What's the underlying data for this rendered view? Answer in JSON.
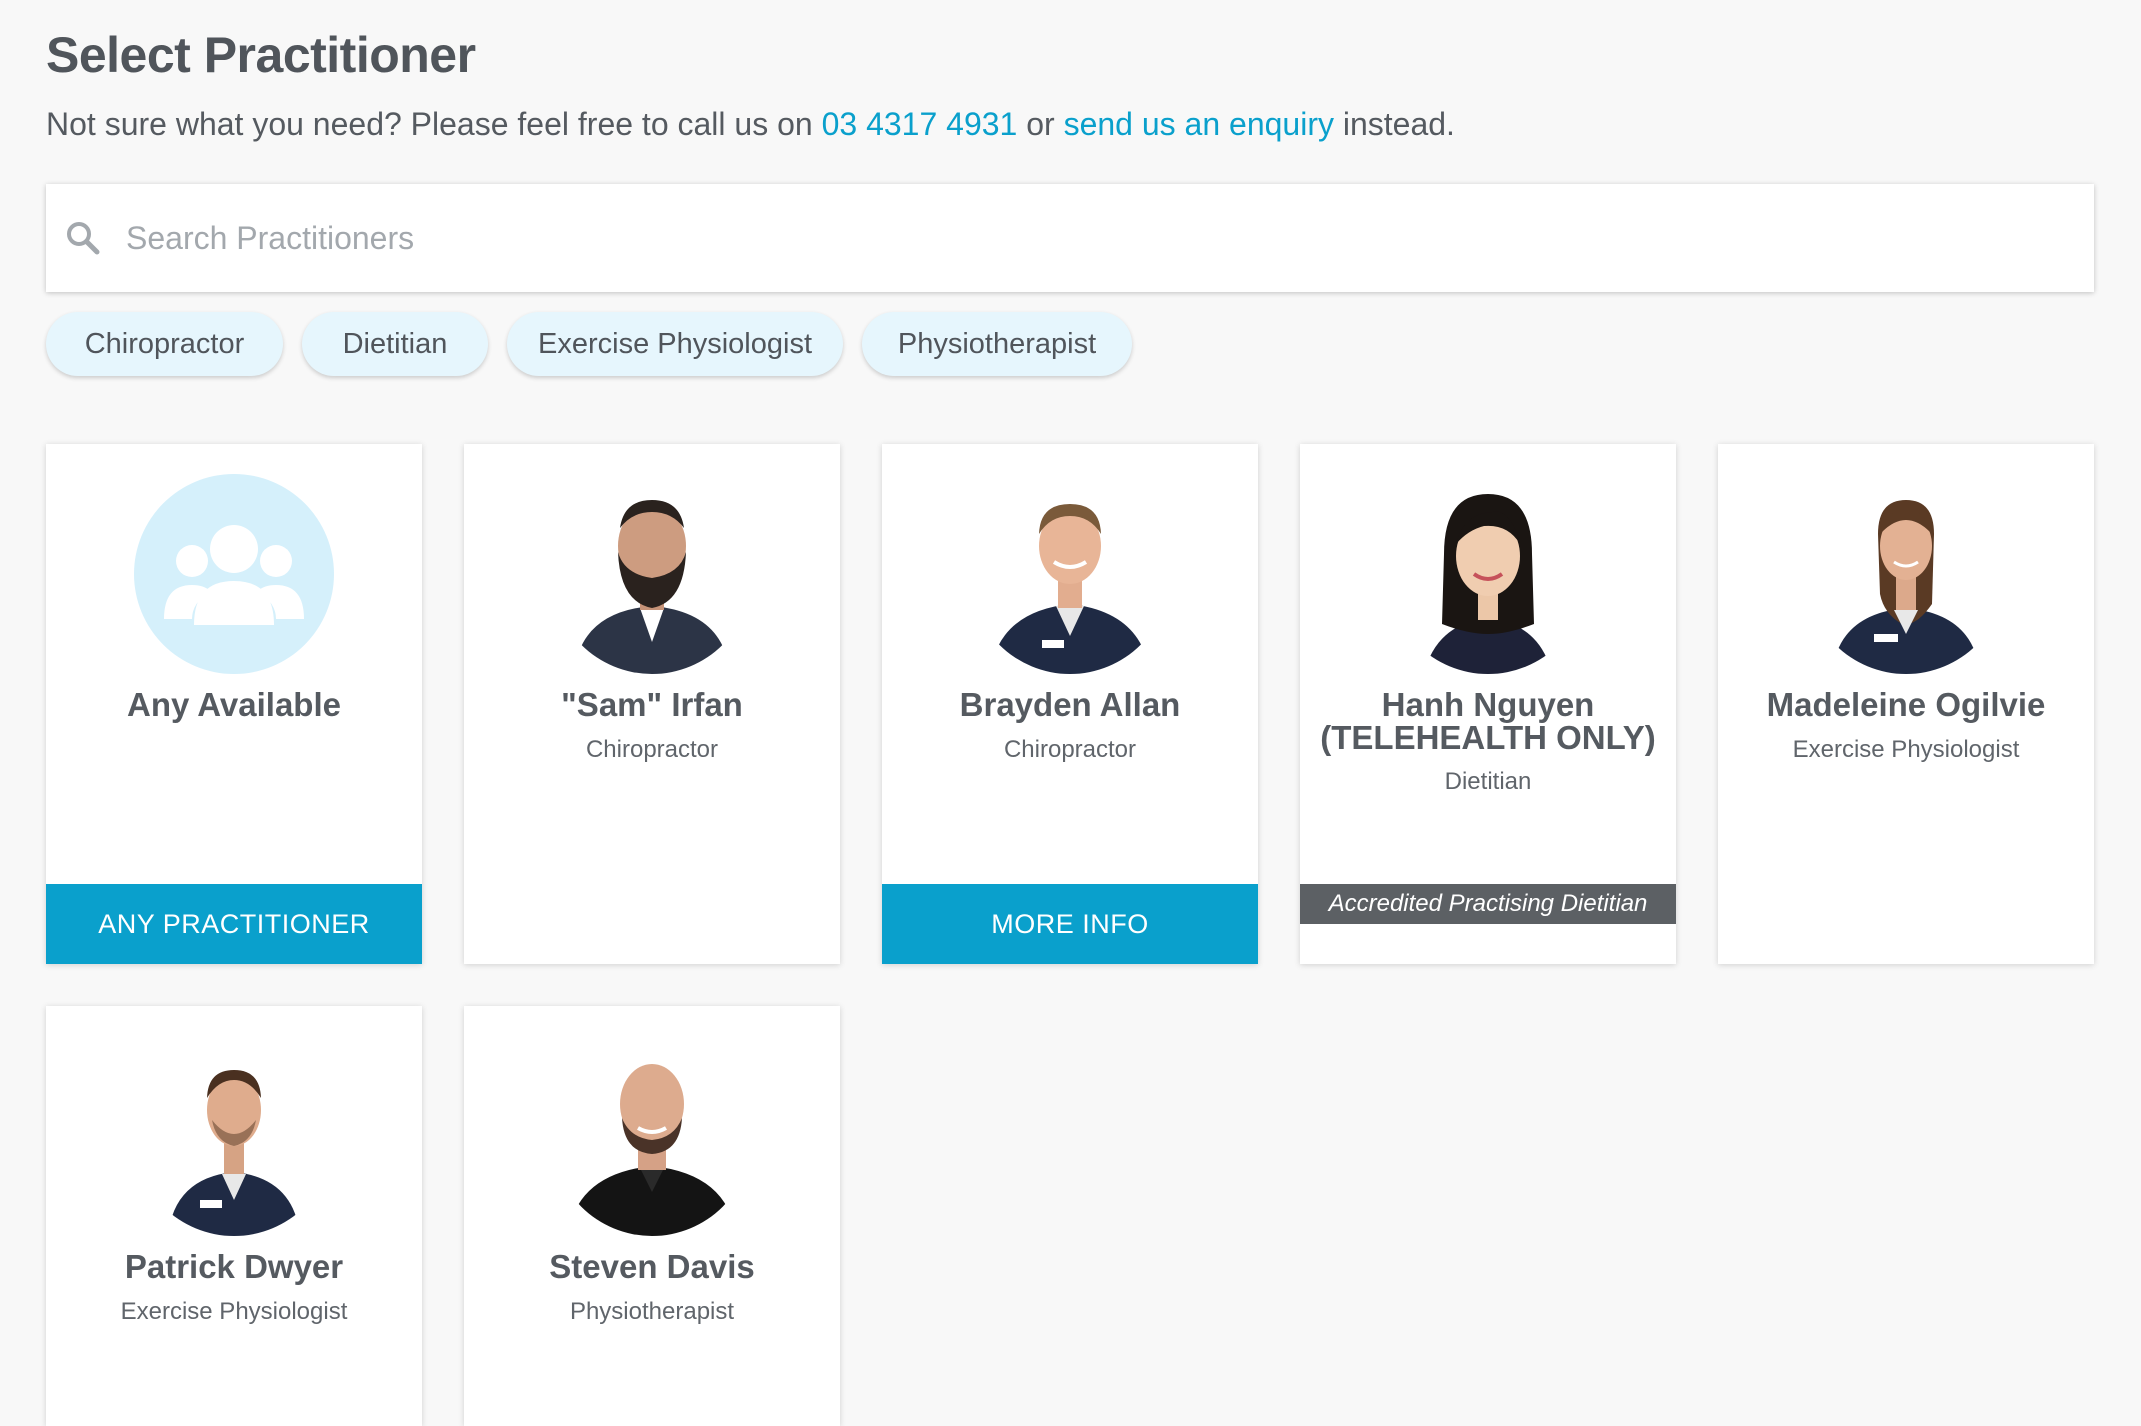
{
  "page": {
    "title": "Select Practitioner",
    "intro_before": "Not sure what you need? Please feel free to call us on ",
    "phone": "03 4317 4931",
    "intro_middle": " or ",
    "enquiry_link": "send us an enquiry",
    "intro_after": " instead."
  },
  "search": {
    "placeholder": "Search Practitioners",
    "icon": "search-icon"
  },
  "filters": [
    "Chiropractor",
    "Dietitian",
    "Exercise Physiologist",
    "Physiotherapist"
  ],
  "cards": [
    {
      "name": "Any Available",
      "role": "",
      "button": "ANY PRACTITIONER",
      "icon": "group-icon"
    },
    {
      "name": "\"Sam\" Irfan",
      "role": "Chiropractor"
    },
    {
      "name": "Brayden Allan",
      "role": "Chiropractor",
      "button": "MORE INFO"
    },
    {
      "name_line1": "Hanh Nguyen",
      "name_line2": "(TELEHEALTH ONLY)",
      "role": "Dietitian",
      "badge": "Accredited Practising Dietitian"
    },
    {
      "name": "Madeleine Ogilvie",
      "role": "Exercise Physiologist"
    },
    {
      "name": "Patrick Dwyer",
      "role": "Exercise Physiologist"
    },
    {
      "name": "Steven Davis",
      "role": "Physiotherapist"
    }
  ],
  "colors": {
    "accent": "#0aa0cc",
    "chip_bg": "#e6f6fd",
    "badge_bg": "#5c6064",
    "avatar_bg": "#d5f0fb"
  }
}
